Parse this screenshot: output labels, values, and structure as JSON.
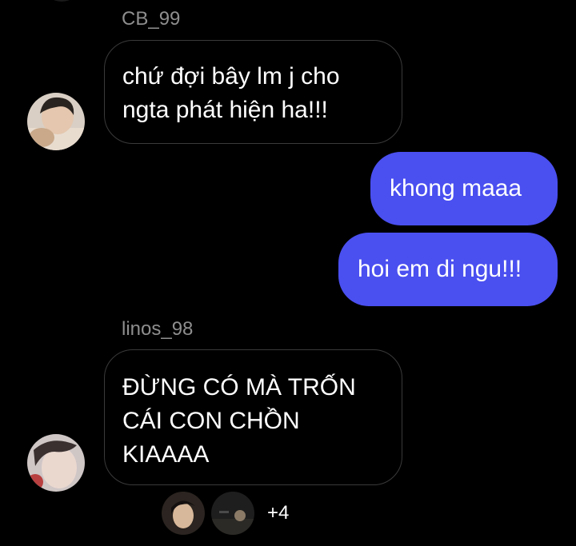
{
  "messages": [
    {
      "sender": "CB_99",
      "text_lines": [
        "chứ đợi bây lm j cho",
        "ngta phát hiện ha!!!"
      ]
    },
    {
      "text": "khong maaa"
    },
    {
      "text": "hoi em di ngu!!!"
    },
    {
      "sender": "linos_98",
      "text_lines": [
        "ĐỪNG CÓ MÀ TRỐN",
        "CÁI CON CHỒN",
        "KIAAAA"
      ]
    }
  ],
  "seen_by": {
    "extra_count": "+4"
  },
  "colors": {
    "background": "#000000",
    "outgoing_bubble": "#4a4ff0",
    "incoming_border": "#3a3a3a",
    "sender_name": "#8e8e8e"
  }
}
